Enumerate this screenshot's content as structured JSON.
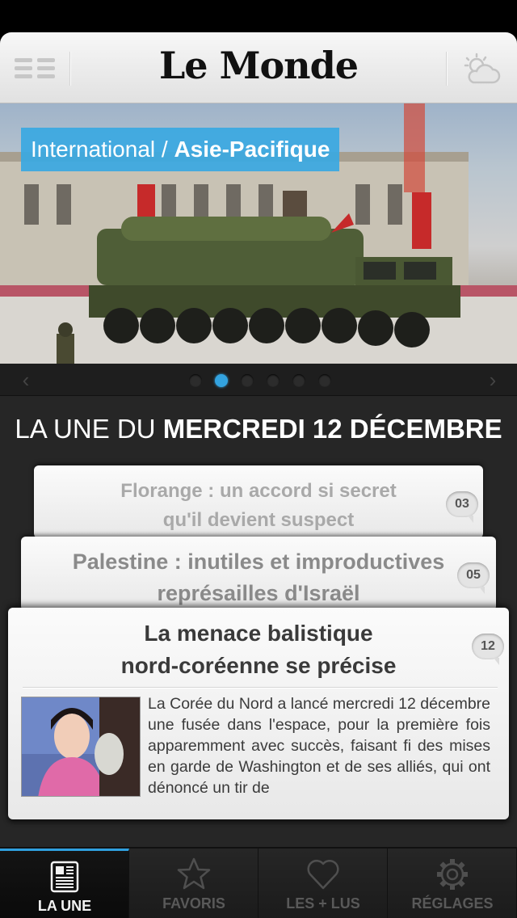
{
  "header": {
    "logo": "Le Monde",
    "menu_icon": "hamburger-menu-icon",
    "weather_icon": "weather-cloud-sun-icon"
  },
  "hero": {
    "category": "International",
    "separator": " / ",
    "subcategory": "Asie-Pacifique"
  },
  "pager": {
    "prev_icon": "chevron-left-icon",
    "next_icon": "chevron-right-icon",
    "page_count": 6,
    "active_index": 1
  },
  "une": {
    "title_prefix": "LA UNE DU ",
    "title_date": "MERCREDI 12 DÉCEMBRE",
    "articles": [
      {
        "title_line1": "Florange : un accord si secret",
        "title_line2": "qu'il devient suspect",
        "comments": "03"
      },
      {
        "title_line1": "Palestine : inutiles et improductives",
        "title_line2": "représailles d'Israël",
        "comments": "05"
      },
      {
        "title_line1": "La menace balistique",
        "title_line2": "nord-coréenne se précise",
        "comments": "12",
        "excerpt": "La Corée du Nord a lancé mercredi 12 décembre une fusée dans l'espace, pour la première fois apparemment avec succès, faisant fi des mises en garde de Washington et de ses alliés, qui ont dénoncé un tir de"
      }
    ]
  },
  "tabs": [
    {
      "label": "LA UNE",
      "icon": "newspaper-icon",
      "active": true
    },
    {
      "label": "FAVORIS",
      "icon": "star-icon",
      "active": false
    },
    {
      "label": "LES + LUS",
      "icon": "heart-icon",
      "active": false
    },
    {
      "label": "RÉGLAGES",
      "icon": "gear-icon",
      "active": false
    }
  ],
  "colors": {
    "accent": "#33a3e0",
    "category_tag": "#3aa8e2",
    "background": "#262626"
  }
}
